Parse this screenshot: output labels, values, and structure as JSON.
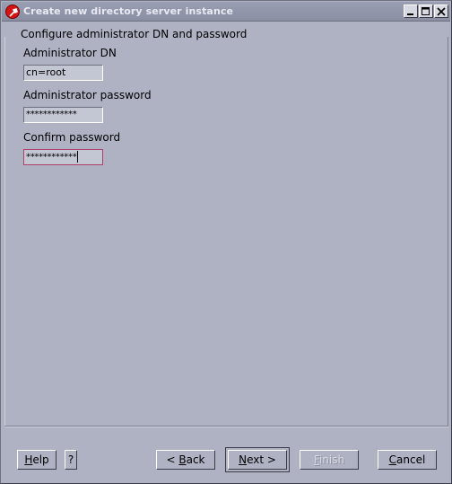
{
  "window": {
    "title": "Create new directory server instance",
    "controls": {
      "minimize": "minimize-icon",
      "maximize": "maximize-icon",
      "close": "close-icon"
    }
  },
  "form": {
    "heading": "Configure administrator DN and password",
    "admin_dn": {
      "label": "Administrator DN",
      "value": "cn=root"
    },
    "admin_password": {
      "label": "Administrator password",
      "value": "************"
    },
    "confirm_password": {
      "label": "Confirm password",
      "value": "************"
    }
  },
  "buttons": {
    "help": {
      "label": "Help",
      "mnemonic": "H",
      "rest": "elp"
    },
    "question": {
      "label": "?"
    },
    "back": {
      "prefix": "< ",
      "mnemonic": "B",
      "rest": "ack"
    },
    "next": {
      "mnemonic": "N",
      "rest": "ext >"
    },
    "finish": {
      "mnemonic": "F",
      "rest": "inish",
      "enabled": false
    },
    "cancel": {
      "mnemonic": "C",
      "rest": "ancel"
    }
  },
  "colors": {
    "background": "#aeb2c3",
    "titlebar": "#8a8ea3",
    "focus_border": "#b0406a"
  }
}
